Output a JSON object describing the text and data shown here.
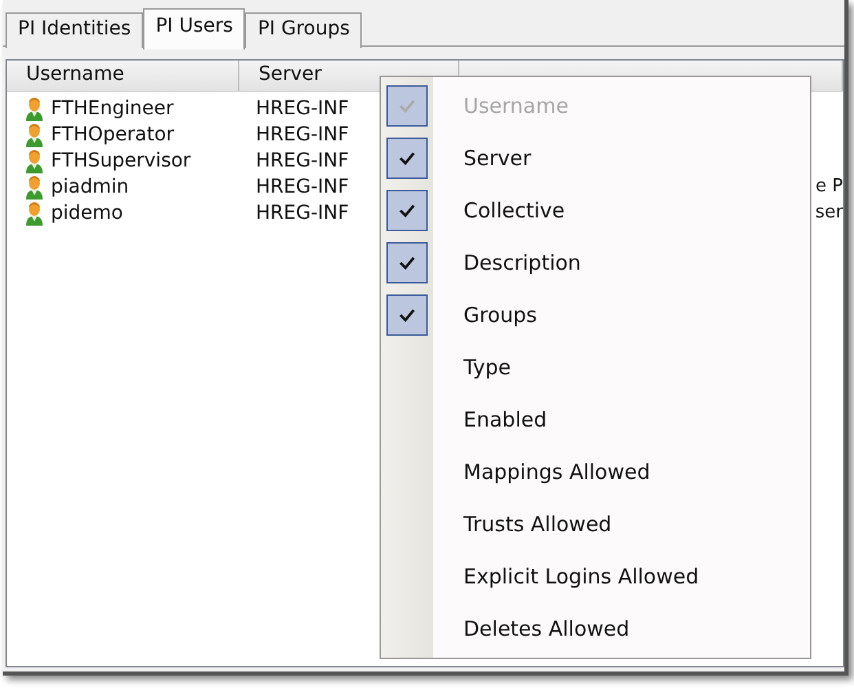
{
  "tabs": [
    {
      "label": "PI Identities",
      "selected": false
    },
    {
      "label": "PI Users",
      "selected": true
    },
    {
      "label": "PI Groups",
      "selected": false
    }
  ],
  "list": {
    "columns": [
      "Username",
      "Server"
    ],
    "rows": [
      {
        "name": "FTHEngineer",
        "server": "HREG-INF"
      },
      {
        "name": "FTHOperator",
        "server": "HREG-INF"
      },
      {
        "name": "FTHSupervisor",
        "server": "HREG-INF"
      },
      {
        "name": "piadmin",
        "server": "HREG-INF",
        "description": "e P"
      },
      {
        "name": "pidemo",
        "server": "HREG-INF",
        "description": "ser"
      }
    ]
  },
  "context_menu": {
    "items": [
      {
        "label": "Username",
        "checked": true,
        "disabled": true
      },
      {
        "label": "Server",
        "checked": true,
        "disabled": false
      },
      {
        "label": "Collective",
        "checked": true,
        "disabled": false
      },
      {
        "label": "Description",
        "checked": true,
        "disabled": false
      },
      {
        "label": "Groups",
        "checked": true,
        "disabled": false
      },
      {
        "label": "Type",
        "checked": false,
        "disabled": false
      },
      {
        "label": "Enabled",
        "checked": false,
        "disabled": false
      },
      {
        "label": "Mappings Allowed",
        "checked": false,
        "disabled": false
      },
      {
        "label": "Trusts Allowed",
        "checked": false,
        "disabled": false
      },
      {
        "label": "Explicit Logins Allowed",
        "checked": false,
        "disabled": false
      },
      {
        "label": "Deletes Allowed",
        "checked": false,
        "disabled": false
      }
    ]
  }
}
